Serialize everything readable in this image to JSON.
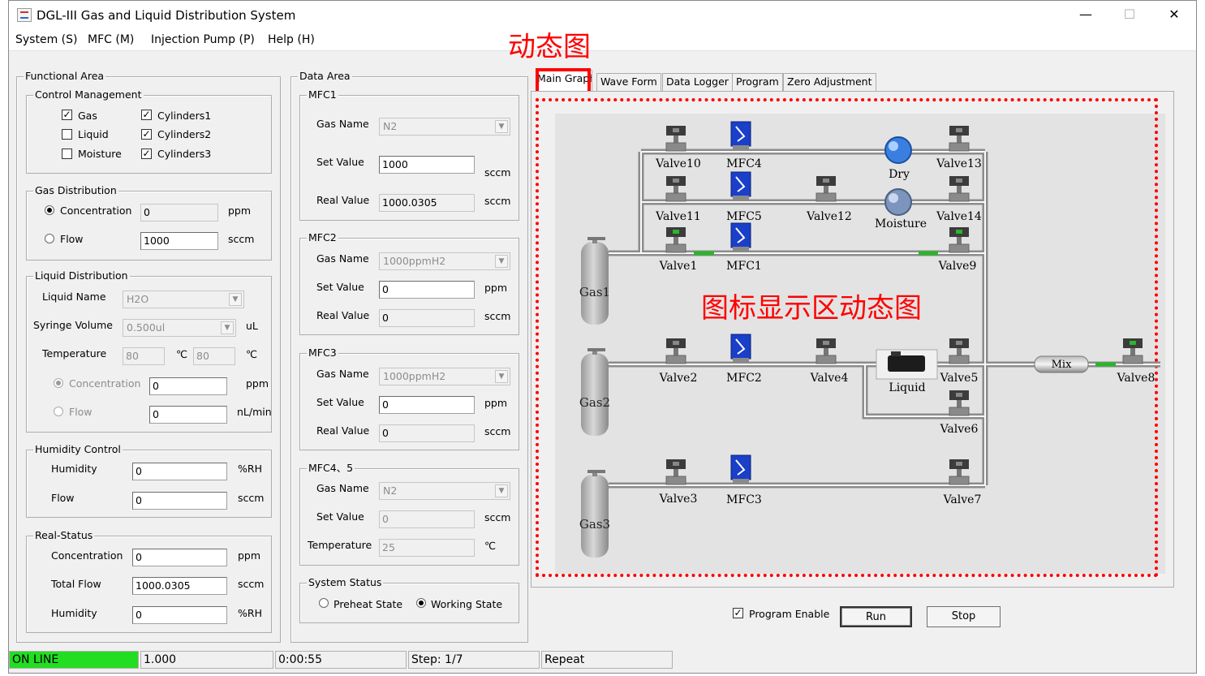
{
  "window": {
    "title": "DGL-III Gas and Liquid Distribution System",
    "min": "—",
    "max": "☐",
    "close": "✕"
  },
  "menu": [
    "System (S)",
    "MFC (M)",
    "Injection Pump (P)",
    "Help (H)"
  ],
  "annotations": {
    "tab_note": "动态图",
    "graph_note": "图标显示区动态图"
  },
  "functional_area": {
    "title": "Functional Area",
    "control_management": {
      "title": "Control Management",
      "items": [
        {
          "label": "Gas",
          "checked": true
        },
        {
          "label": "Liquid",
          "checked": false
        },
        {
          "label": "Moisture",
          "checked": false
        },
        {
          "label": "Cylinders1",
          "checked": true
        },
        {
          "label": "Cylinders2",
          "checked": true
        },
        {
          "label": "Cylinders3",
          "checked": true
        }
      ]
    },
    "gas_distribution": {
      "title": "Gas Distribution",
      "concentration_label": "Concentration",
      "concentration_value": "0",
      "concentration_unit": "ppm",
      "flow_label": "Flow",
      "flow_value": "1000",
      "flow_unit": "sccm"
    },
    "liquid_distribution": {
      "title": "Liquid Distribution",
      "liquid_name_label": "Liquid Name",
      "liquid_name_value": "H2O",
      "syringe_label": "Syringe Volume",
      "syringe_value": "0.500ul",
      "syringe_unit": "uL",
      "temp_label": "Temperature",
      "temp_value1": "80",
      "temp_unit1": "℃",
      "temp_value2": "80",
      "temp_unit2": "℃",
      "conc_label": "Concentration",
      "conc_value": "0",
      "conc_unit": "ppm",
      "flow_label": "Flow",
      "flow_value": "0",
      "flow_unit": "nL/min"
    },
    "humidity_control": {
      "title": "Humidity Control",
      "humidity_label": "Humidity",
      "humidity_value": "0",
      "humidity_unit": "%RH",
      "flow_label": "Flow",
      "flow_value": "0",
      "flow_unit": "sccm"
    },
    "real_status": {
      "title": "Real-Status",
      "conc_label": "Concentration",
      "conc_value": "0",
      "conc_unit": "ppm",
      "total_flow_label": "Total Flow",
      "total_flow_value": "1000.0305",
      "total_flow_unit": "sccm",
      "humidity_label": "Humidity",
      "humidity_value": "0",
      "humidity_unit": "%RH"
    }
  },
  "data_area": {
    "title": "Data Area",
    "mfc1": {
      "title": "MFC1",
      "gas_label": "Gas Name",
      "gas_value": "N2",
      "set_label": "Set Value",
      "set_value": "1000",
      "set_unit": "sccm",
      "real_label": "Real Value",
      "real_value": "1000.0305",
      "real_unit": "sccm"
    },
    "mfc2": {
      "title": "MFC2",
      "gas_label": "Gas Name",
      "gas_value": "1000ppmH2",
      "set_label": "Set Value",
      "set_value": "0",
      "set_unit": "ppm",
      "real_label": "Real Value",
      "real_value": "0",
      "real_unit": "sccm"
    },
    "mfc3": {
      "title": "MFC3",
      "gas_label": "Gas Name",
      "gas_value": "1000ppmH2",
      "set_label": "Set Value",
      "set_value": "0",
      "set_unit": "ppm",
      "real_label": "Real Value",
      "real_value": "0",
      "real_unit": "sccm"
    },
    "mfc45": {
      "title": "MFC4、5",
      "gas_label": "Gas Name",
      "gas_value": "N2",
      "set_label": "Set Value",
      "set_value": "0",
      "set_unit": "sccm",
      "temp_label": "Temperature",
      "temp_value": "25",
      "temp_unit": "℃"
    },
    "system_status": {
      "title": "System Status",
      "preheat": "Preheat State",
      "working": "Working State"
    }
  },
  "tabs": [
    "Main Graph",
    "Wave Form",
    "Data Logger",
    "Program",
    "Zero Adjustment"
  ],
  "diagram": {
    "valves": [
      "Valve10",
      "Valve13",
      "Valve11",
      "Valve12",
      "Valve14",
      "Valve1",
      "Valve9",
      "Valve2",
      "Valve4",
      "Valve5",
      "Valve8",
      "Valve6",
      "Valve3",
      "Valve7"
    ],
    "mfcs": [
      "MFC4",
      "MFC5",
      "MFC1",
      "MFC2",
      "MFC3"
    ],
    "gases": [
      "Gas1",
      "Gas2",
      "Gas3"
    ],
    "dry": "Dry",
    "moisture": "Moisture",
    "liquid": "Liquid",
    "mix": "Mix"
  },
  "controls": {
    "program_enable": "Program Enable",
    "run": "Run",
    "stop": "Stop"
  },
  "status_bar": {
    "online": "ON LINE",
    "value": "1.000",
    "time": "0:00:55",
    "step": "Step: 1/7",
    "mode": "Repeat"
  },
  "colors": {
    "online": "#22dd22",
    "annotation": "#ff0000",
    "mfc_blue": "#1a3fc8"
  }
}
